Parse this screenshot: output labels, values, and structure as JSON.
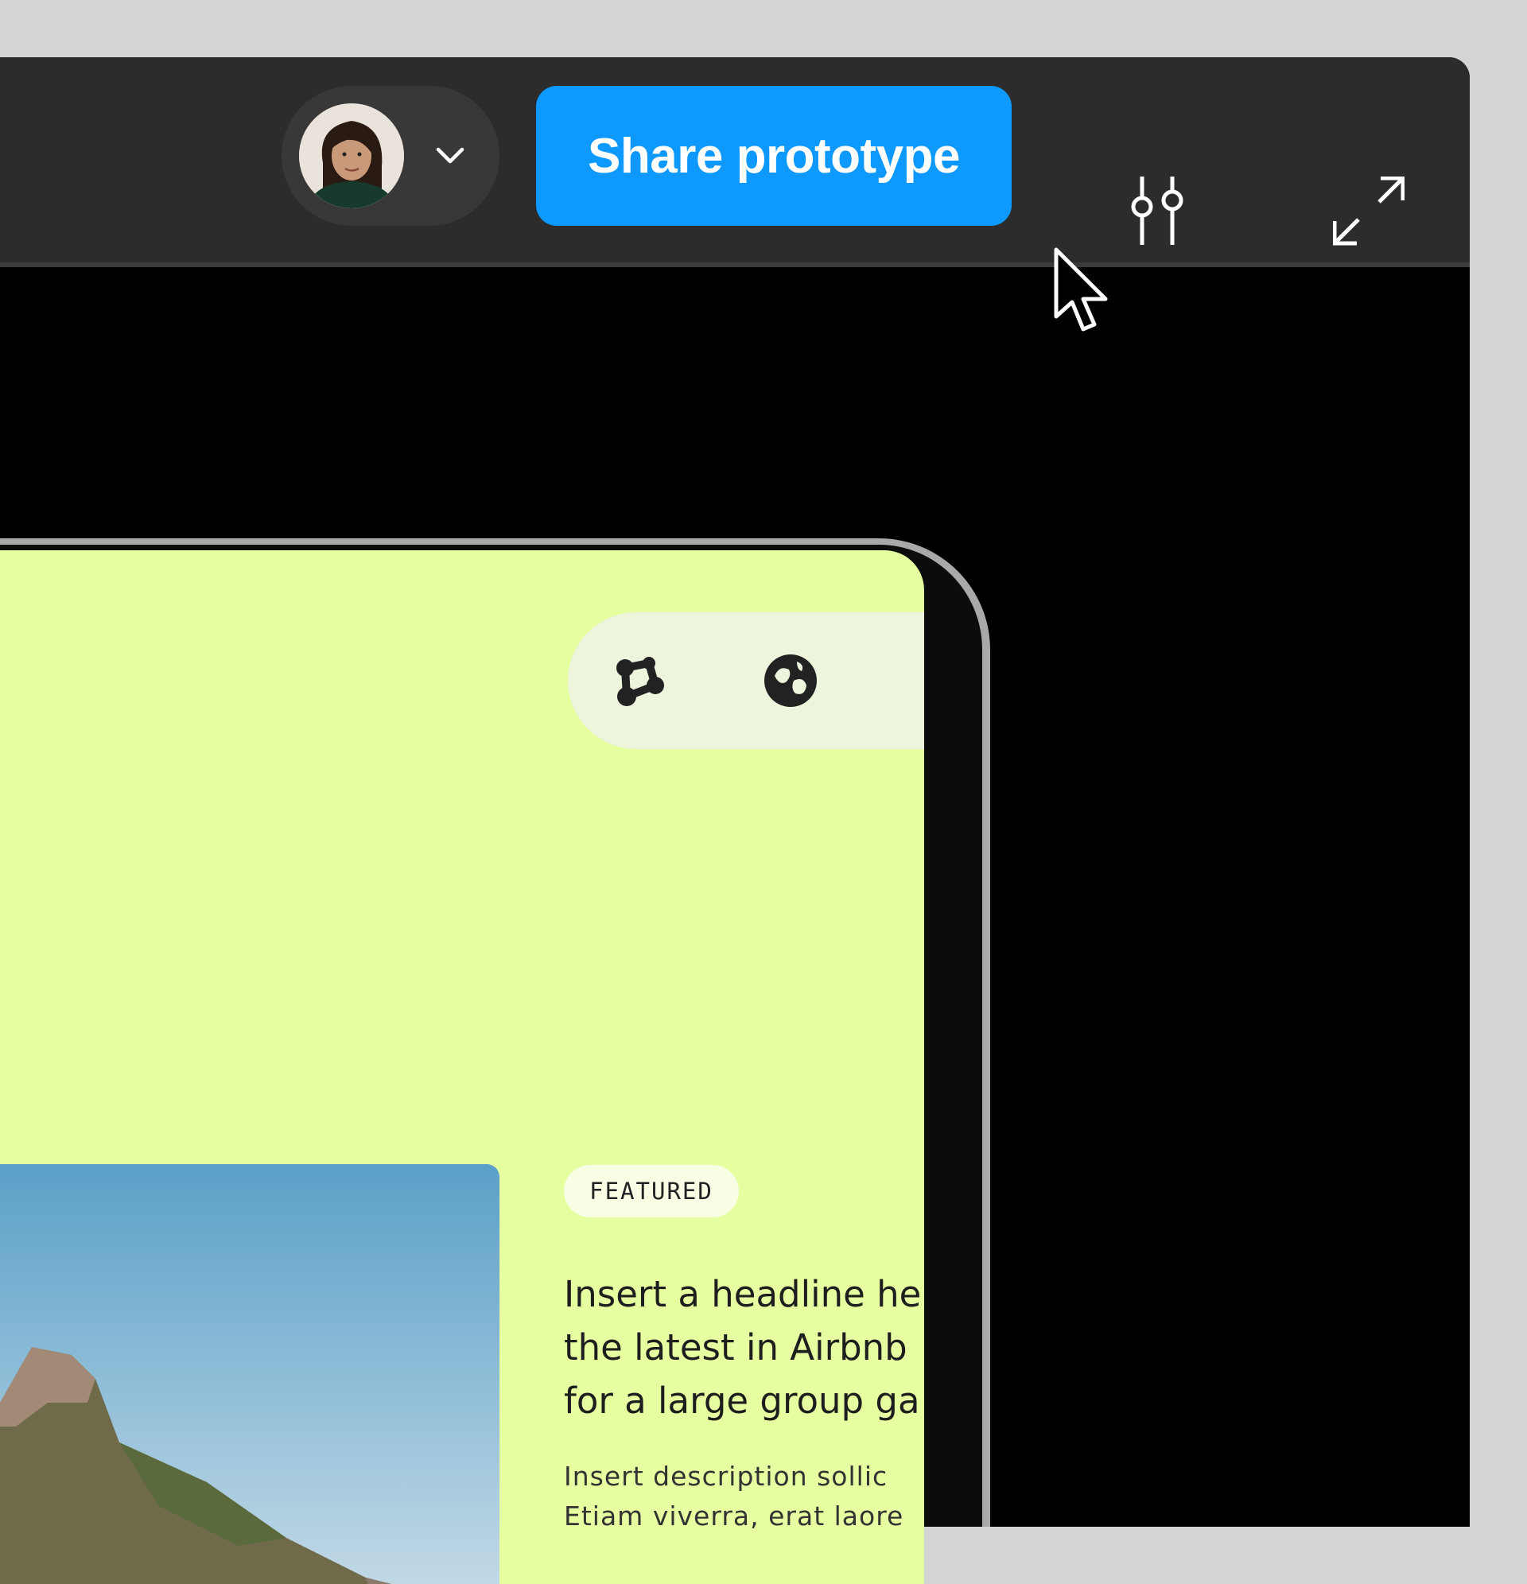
{
  "toolbar": {
    "share_label": "Share prototype"
  },
  "icons": {
    "avatar": "user-avatar",
    "dropdown": "chevron-down-icon",
    "settings": "sliders-icon",
    "expand": "expand-icon",
    "cursor": "mouse-pointer-icon",
    "nav_1": "molecule-icon",
    "nav_2": "globe-blob-icon"
  },
  "colors": {
    "toolbar_bg": "#2c2c2c",
    "share_button": "#0d99ff",
    "screen_bg": "#e6ffa0"
  },
  "card": {
    "badge": "FEATURED",
    "headline_lines": [
      "Insert a headline he",
      "the latest in Airbnb",
      "for a large group ga"
    ],
    "description_lines": [
      "Insert description sollic",
      "Etiam viverra, erat laore"
    ]
  }
}
